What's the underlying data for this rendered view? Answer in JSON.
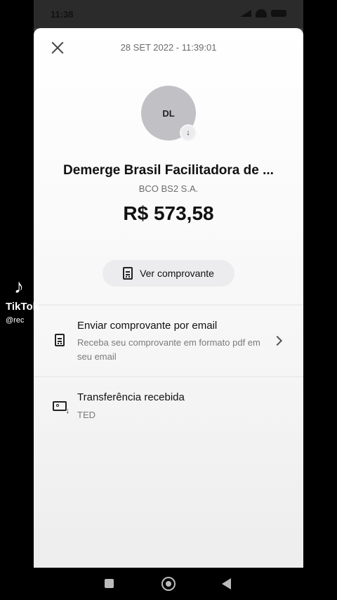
{
  "status_bar": {
    "time": "11:38"
  },
  "sheet": {
    "datetime": "28 SET 2022 - 11:39:01",
    "avatar_initials": "DL",
    "avatar_badge_icon": "arrow-down-icon",
    "payee_name": "Demerge Brasil Facilitadora de ...",
    "bank_name": "BCO BS2 S.A.",
    "amount": "R$ 573,58",
    "view_receipt_label": "Ver comprovante",
    "email_row": {
      "title": "Enviar comprovante por email",
      "subtitle": "Receba seu comprovante em formato pdf em seu email"
    },
    "transfer_row": {
      "title": "Transferência recebida",
      "subtitle": "TED"
    }
  },
  "overlay": {
    "brand": "TikTok",
    "handle": "@rec"
  },
  "colors": {
    "accent": "#111111",
    "muted": "#6b6b6b",
    "pill_bg": "#ececee"
  }
}
